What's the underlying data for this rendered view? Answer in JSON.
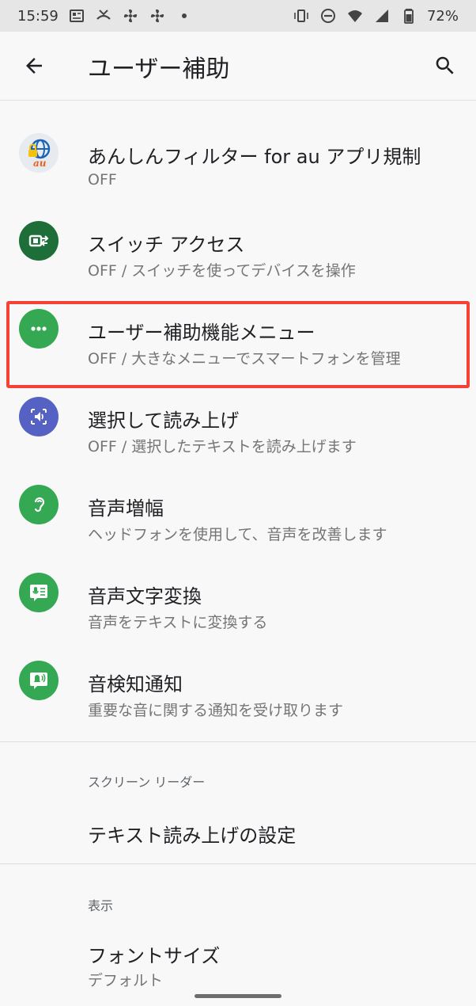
{
  "status_bar": {
    "time": "15:59",
    "battery": "72%"
  },
  "app_bar": {
    "title": "ユーザー補助"
  },
  "items": [
    {
      "title": "あんしんフィルター for au アプリ規制",
      "sub": "OFF",
      "icon": "anshin-filter-icon",
      "color": "#e7eaef",
      "logo_text": "au"
    },
    {
      "title": "スイッチ アクセス",
      "sub": "OFF / スイッチを使ってデバイスを操作",
      "icon": "switch-access-icon",
      "color": "#1e6e3a"
    },
    {
      "title": "ユーザー補助機能メニュー",
      "sub": "OFF / 大きなメニューでスマートフォンを管理",
      "icon": "more-horiz-icon",
      "color": "#34a853"
    },
    {
      "title": "選択して読み上げ",
      "sub": "OFF / 選択したテキストを読み上げます",
      "icon": "select-to-speak-icon",
      "color": "#5561c3"
    },
    {
      "title": "音声増幅",
      "sub": "ヘッドフォンを使用して、音声を改善します",
      "icon": "ear-icon",
      "color": "#34a853"
    },
    {
      "title": "音声文字変換",
      "sub": "音声をテキストに変換する",
      "icon": "live-transcribe-icon",
      "color": "#34a853"
    },
    {
      "title": "音検知通知",
      "sub": "重要な音に関する通知を受け取ります",
      "icon": "sound-notify-icon",
      "color": "#34a853"
    }
  ],
  "screen_reader": {
    "header": "スクリーン リーダー",
    "tts_label": "テキスト読み上げの設定"
  },
  "display": {
    "header": "表示",
    "font_size_label": "フォントサイズ",
    "font_size_value": "デフォルト"
  },
  "colors": {
    "highlight": "#f44336"
  }
}
